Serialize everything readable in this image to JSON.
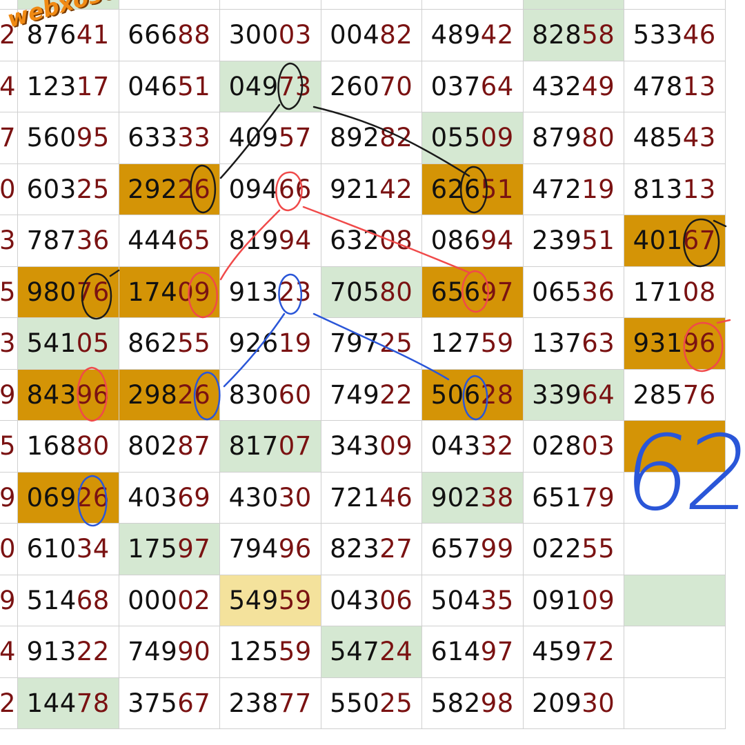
{
  "watermark": "webxoso.net",
  "handwritten_note": "62",
  "colors": {
    "orange": "#d49406",
    "green": "#d5e8d2",
    "yellow": "#f4e29c",
    "digit_dark": "#111111",
    "digit_red": "#7a1212",
    "ink_black": "#1a1a1a",
    "ink_red": "#f04a4a",
    "ink_blue": "#2a56d8"
  },
  "left_edge_digits": [
    "2",
    "4",
    "7",
    "0",
    "3",
    "5",
    "3",
    "9",
    "5",
    "9",
    "0",
    "9",
    "4",
    "2"
  ],
  "rows": [
    [
      {
        "v": "87641"
      },
      {
        "v": "66688"
      },
      {
        "v": "30003"
      },
      {
        "v": "00482"
      },
      {
        "v": "48942"
      },
      {
        "v": "82858",
        "c": "green"
      },
      {
        "v": "53346"
      }
    ],
    [
      {
        "v": "12317"
      },
      {
        "v": "04651"
      },
      {
        "v": "04973",
        "c": "green"
      },
      {
        "v": "26070"
      },
      {
        "v": "03764"
      },
      {
        "v": "43249"
      },
      {
        "v": "47813"
      }
    ],
    [
      {
        "v": "56095"
      },
      {
        "v": "63333"
      },
      {
        "v": "40957"
      },
      {
        "v": "89282"
      },
      {
        "v": "05509",
        "c": "green"
      },
      {
        "v": "87980"
      },
      {
        "v": "48543"
      }
    ],
    [
      {
        "v": "60325"
      },
      {
        "v": "29226",
        "c": "orange"
      },
      {
        "v": "09466"
      },
      {
        "v": "92142"
      },
      {
        "v": "62651",
        "c": "orange"
      },
      {
        "v": "47219"
      },
      {
        "v": "81313"
      }
    ],
    [
      {
        "v": "78736"
      },
      {
        "v": "44465"
      },
      {
        "v": "81994"
      },
      {
        "v": "63208"
      },
      {
        "v": "08694"
      },
      {
        "v": "23951"
      },
      {
        "v": "40167",
        "c": "orange"
      }
    ],
    [
      {
        "v": "98076",
        "c": "orange"
      },
      {
        "v": "17409",
        "c": "orange"
      },
      {
        "v": "91323"
      },
      {
        "v": "70580",
        "c": "green"
      },
      {
        "v": "65697",
        "c": "orange"
      },
      {
        "v": "06536"
      },
      {
        "v": "17108"
      }
    ],
    [
      {
        "v": "54105",
        "c": "green"
      },
      {
        "v": "86255"
      },
      {
        "v": "92619"
      },
      {
        "v": "79725"
      },
      {
        "v": "12759"
      },
      {
        "v": "13763"
      },
      {
        "v": "93196",
        "c": "orange"
      }
    ],
    [
      {
        "v": "84396",
        "c": "orange"
      },
      {
        "v": "29826",
        "c": "orange"
      },
      {
        "v": "83060"
      },
      {
        "v": "74922"
      },
      {
        "v": "50628",
        "c": "orange"
      },
      {
        "v": "33964",
        "c": "green"
      },
      {
        "v": "28576"
      }
    ],
    [
      {
        "v": "16880"
      },
      {
        "v": "80287"
      },
      {
        "v": "81707",
        "c": "green"
      },
      {
        "v": "34309"
      },
      {
        "v": "04332"
      },
      {
        "v": "02803"
      },
      {
        "v": "",
        "c": "orange"
      }
    ],
    [
      {
        "v": "06926",
        "c": "orange"
      },
      {
        "v": "40369"
      },
      {
        "v": "43030"
      },
      {
        "v": "72146"
      },
      {
        "v": "90238",
        "c": "green"
      },
      {
        "v": "65179"
      },
      {
        "v": ""
      }
    ],
    [
      {
        "v": "61034"
      },
      {
        "v": "17597",
        "c": "green"
      },
      {
        "v": "79496"
      },
      {
        "v": "82327"
      },
      {
        "v": "65799"
      },
      {
        "v": "02255"
      },
      {
        "v": ""
      }
    ],
    [
      {
        "v": "51468"
      },
      {
        "v": "00002"
      },
      {
        "v": "54959",
        "c": "yellow"
      },
      {
        "v": "04306"
      },
      {
        "v": "50435"
      },
      {
        "v": "09109"
      },
      {
        "v": "",
        "c": "green"
      }
    ],
    [
      {
        "v": "91322"
      },
      {
        "v": "74990"
      },
      {
        "v": "12559"
      },
      {
        "v": "54724",
        "c": "green"
      },
      {
        "v": "61497"
      },
      {
        "v": "45972"
      },
      {
        "v": ""
      }
    ],
    [
      {
        "v": "14478",
        "c": "green"
      },
      {
        "v": "37567"
      },
      {
        "v": "23877"
      },
      {
        "v": "55025"
      },
      {
        "v": "58298"
      },
      {
        "v": "20930"
      },
      {
        "v": ""
      }
    ]
  ]
}
